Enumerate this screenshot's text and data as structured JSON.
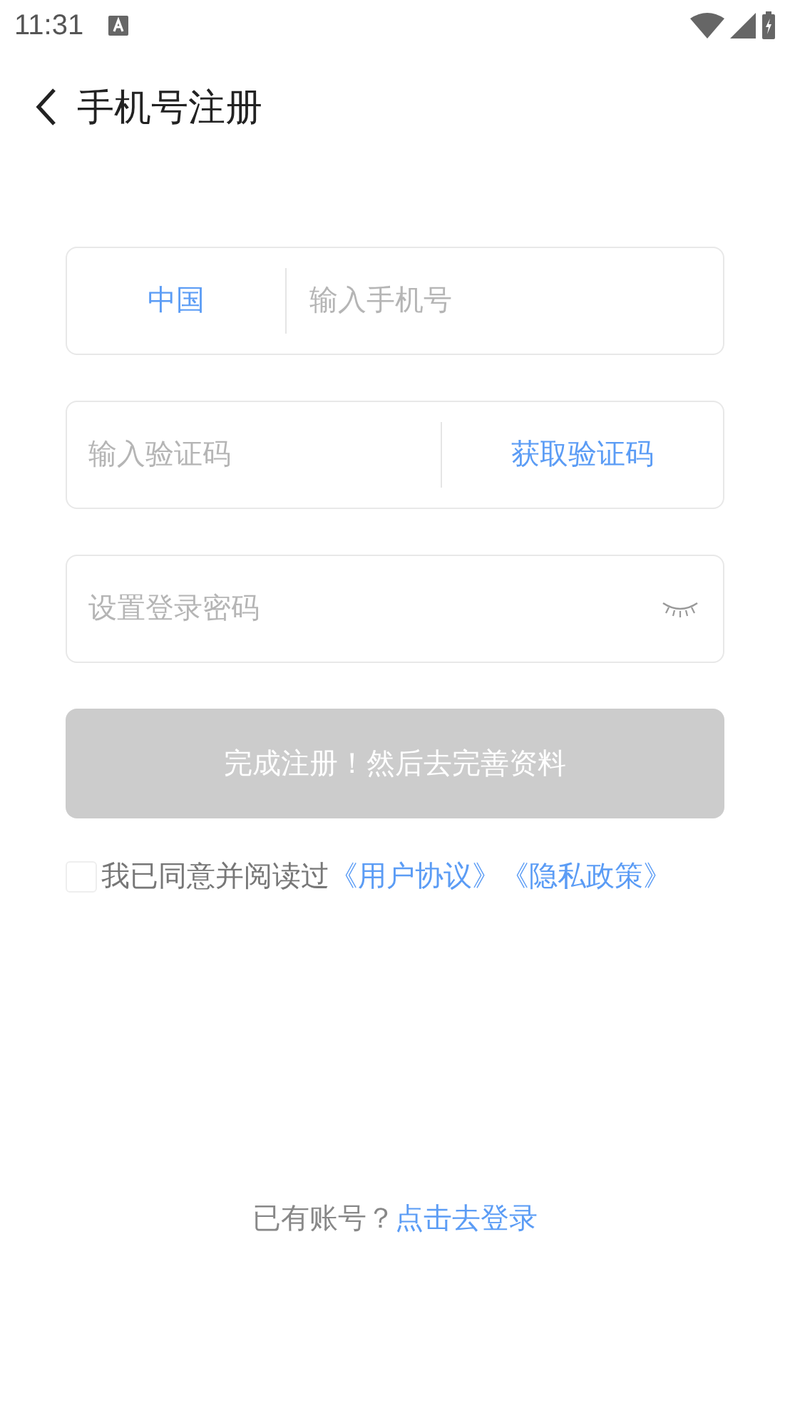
{
  "status_bar": {
    "time": "11:31"
  },
  "header": {
    "title": "手机号注册"
  },
  "phone_field": {
    "country": "中国",
    "placeholder": "输入手机号"
  },
  "code_field": {
    "placeholder": "输入验证码",
    "button": "获取验证码"
  },
  "password_field": {
    "placeholder": "设置登录密码",
    "visible": false
  },
  "submit_button": {
    "label": "完成注册！然后去完善资料",
    "disabled": true
  },
  "agreement": {
    "checked": false,
    "text": "我已同意并阅读过",
    "links": [
      "《用户协议》",
      "《隐私政策》"
    ]
  },
  "footer": {
    "text": "已有账号？",
    "link": "点击去登录"
  }
}
